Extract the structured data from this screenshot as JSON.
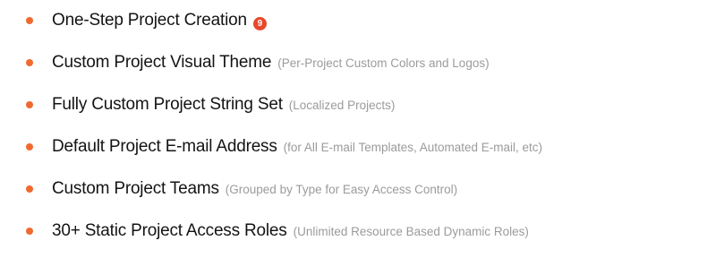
{
  "colors": {
    "bullet": "#f06a2f",
    "badge": "#e8472b"
  },
  "features": [
    {
      "title": "One-Step Project Creation",
      "note": "",
      "badge": "9"
    },
    {
      "title": "Custom Project Visual Theme",
      "note": "(Per-Project Custom Colors and Logos)",
      "badge": ""
    },
    {
      "title": "Fully Custom Project String Set",
      "note": "(Localized Projects)",
      "badge": ""
    },
    {
      "title": "Default Project E-mail Address",
      "note": "(for All E-mail Templates, Automated E-mail, etc)",
      "badge": ""
    },
    {
      "title": "Custom Project Teams",
      "note": "(Grouped by Type for Easy Access Control)",
      "badge": ""
    },
    {
      "title": "30+ Static Project Access Roles",
      "note": "(Unlimited Resource Based Dynamic Roles)",
      "badge": ""
    }
  ]
}
